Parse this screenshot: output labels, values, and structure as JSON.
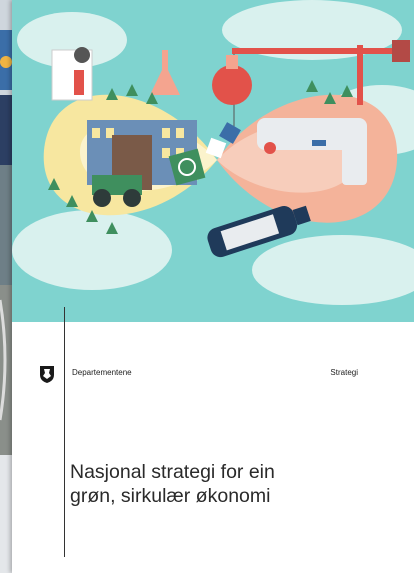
{
  "cover": {
    "publisher": "Departementene",
    "document_type": "Strategi",
    "title_line1": "Nasjonal strategi for ein",
    "title_line2": "grøn, sirkulær økonomi"
  },
  "colors": {
    "sky": "#7fd3cf",
    "loop_yellow": "#f7e7a0",
    "loop_salmon": "#f4a48f",
    "accent_red": "#e2524a",
    "navy": "#1f3a5a"
  },
  "icons": [
    "coat-of-arms-icon",
    "recycle-icon"
  ]
}
